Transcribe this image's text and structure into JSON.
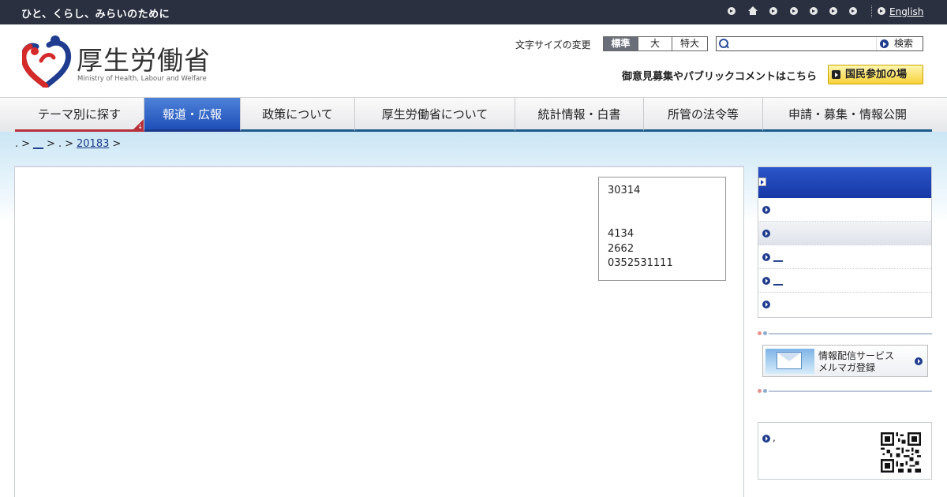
{
  "topbar": {
    "tagline": "ひと、くらし、みらいのために",
    "english_link": "English"
  },
  "header": {
    "logo_title": "厚生労働省",
    "logo_subtitle": "Ministry of Health, Labour and Welfare",
    "font_size_label": "文字サイズの変更",
    "font_sizes": [
      "標準",
      "大",
      "特大"
    ],
    "search_placeholder": "",
    "search_button": "検索",
    "public_comment_text": "御意見募集やパブリックコメントはこちら",
    "participate_button": "国民参加の場"
  },
  "nav": {
    "tabs": [
      "テーマ別に探す",
      "報道・広報",
      "政策について",
      "厚生労働省について",
      "統計情報・白書",
      "所管の法令等",
      "申請・募集・情報公開"
    ],
    "active_tab": "報道・広報"
  },
  "breadcrumb": {
    "item0": ".",
    "item1": "__",
    "item2": ".",
    "item3": "20183"
  },
  "contact": {
    "line1": "30314",
    "line2": "4134",
    "line3": "2662",
    "line4": "0352531111"
  },
  "sidebar": {
    "items": [
      "",
      "",
      "__",
      "__",
      ""
    ]
  },
  "mailmag": {
    "line1": "情報配信サービス",
    "line2": "メルマガ登録"
  },
  "qr": {
    "text": ","
  },
  "colors": {
    "topbar": "#2b3040",
    "nav_active": "#1e4fb8",
    "sidebar_head": "#1738a6",
    "accent_red": "#b5323a"
  }
}
